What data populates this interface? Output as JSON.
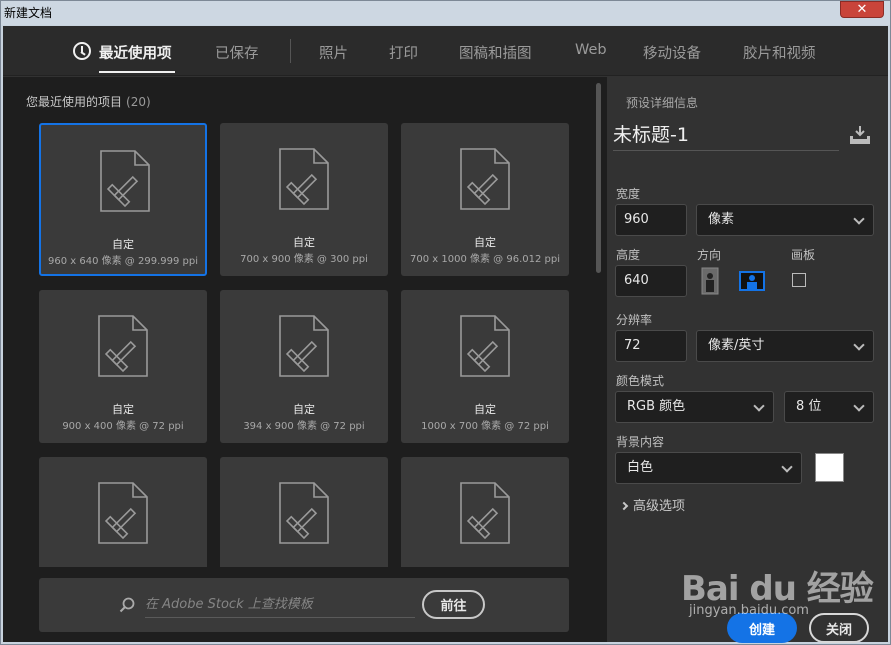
{
  "window": {
    "title": "新建文档",
    "close_glyph": "✕"
  },
  "tabs": [
    {
      "label": "最近使用项",
      "active": true
    },
    {
      "label": "已保存"
    },
    {
      "label": "照片"
    },
    {
      "label": "打印"
    },
    {
      "label": "图稿和插图"
    },
    {
      "label": "Web"
    },
    {
      "label": "移动设备"
    },
    {
      "label": "胶片和视频"
    }
  ],
  "recent": {
    "title": "您最近使用的项目",
    "count": "(20)",
    "items": [
      {
        "name": "自定",
        "info": "960 x 640 像素 @ 299.999 ppi",
        "selected": true
      },
      {
        "name": "自定",
        "info": "700 x 900 像素 @ 300 ppi"
      },
      {
        "name": "自定",
        "info": "700 x 1000 像素 @ 96.012 ppi"
      },
      {
        "name": "自定",
        "info": "900 x 400 像素 @ 72 ppi"
      },
      {
        "name": "自定",
        "info": "394 x 900 像素 @ 72 ppi"
      },
      {
        "name": "自定",
        "info": "1000 x 700 像素 @ 72 ppi"
      },
      {
        "name": "",
        "info": ""
      },
      {
        "name": "",
        "info": ""
      },
      {
        "name": "",
        "info": ""
      }
    ]
  },
  "stock": {
    "placeholder": "在 Adobe Stock 上查找模板",
    "go_label": "前往"
  },
  "preset": {
    "header": "预设详细信息",
    "doc_title": "未标题-1",
    "width_label": "宽度",
    "width_value": "960",
    "width_unit": "像素",
    "height_label": "高度",
    "height_value": "640",
    "orientation_label": "方向",
    "artboard_label": "画板",
    "resolution_label": "分辨率",
    "resolution_value": "72",
    "resolution_unit": "像素/英寸",
    "color_mode_label": "颜色模式",
    "color_mode": "RGB 颜色",
    "bit_depth": "8 位",
    "background_label": "背景内容",
    "background": "白色",
    "background_color": "#ffffff",
    "advanced_label": "高级选项",
    "create_label": "创建",
    "close_label": "关闭"
  },
  "colors": {
    "accent": "#1473e6"
  },
  "watermark": {
    "brand": "Bai du 经验",
    "url": "jingyan.baidu.com"
  }
}
